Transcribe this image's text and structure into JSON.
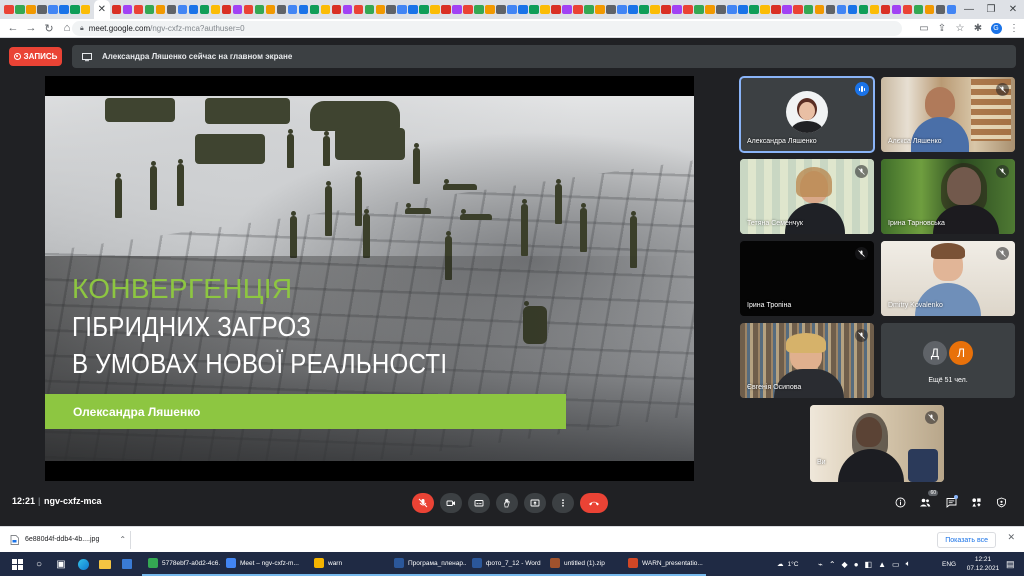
{
  "browser": {
    "url_host": "meet.google.com",
    "url_path": "/ngv-cxfz-mca?authuser=0",
    "profile_initial": "G",
    "close_tab_glyph": "✕"
  },
  "meet": {
    "record_label": "ЗАПИСЬ",
    "presenting_text": "Александра Ляшенко сейчас на главном экране",
    "time": "12:21",
    "code": "ngv-cxfz-mca"
  },
  "slide": {
    "title_line1": "КОНВЕРГЕНЦІЯ",
    "title_line2": "ГІБРИДНИХ ЗАГРОЗ",
    "title_line3": "В УМОВАХ НОВОЇ РЕАЛЬНОСТІ",
    "author": "Олександра Ляшенко",
    "accent_color": "#8dc641"
  },
  "participants": [
    {
      "name": "Александра Ляшенко",
      "speaking": true
    },
    {
      "name": "Алєкса Ляшенко",
      "speaking": false
    },
    {
      "name": "Тетяна Семенчук",
      "speaking": false
    },
    {
      "name": "Ірина Тарновська",
      "speaking": false
    },
    {
      "name": "Ірина Тропіна",
      "speaking": false
    },
    {
      "name": "Dmitry Kovalenko",
      "speaking": false
    },
    {
      "name": "Євгенія Осипова",
      "speaking": false
    },
    {
      "name": "Ви",
      "speaking": false
    }
  ],
  "more": {
    "avatar1": "Д",
    "avatar2": "Л",
    "label": "Ещё 51 чел."
  },
  "controls": {
    "people_count": "60"
  },
  "downloads": {
    "file_name": "6e880d4f-ddb4-4b....jpg",
    "show_all": "Показать все"
  },
  "taskbar": {
    "apps": [
      {
        "label": "5778ebf7-a0d2-4c6...",
        "color": "#34a853"
      },
      {
        "label": "Meet – ngv-cxfz-m...",
        "color": "#4285f4"
      },
      {
        "label": "warn",
        "color": "#f4b400"
      },
      {
        "label": "Програма_пленар...",
        "color": "#2b579a"
      },
      {
        "label": "фото_7_12 - Word",
        "color": "#2b579a"
      },
      {
        "label": "untitled (1).zip",
        "color": "#a0522d"
      },
      {
        "label": "WARN_presentatio...",
        "color": "#d24726"
      }
    ],
    "temperature": "1°C",
    "language": "ENG",
    "clock_time": "12:21",
    "clock_date": "07.12.2021"
  }
}
